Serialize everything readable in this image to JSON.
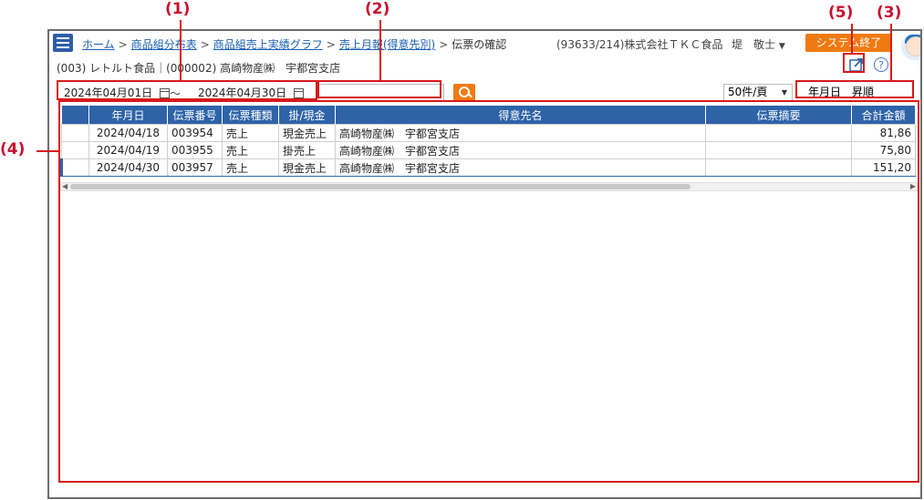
{
  "annotations": {
    "n1": "(1)",
    "n2": "(2)",
    "n3": "(3)",
    "n4": "(4)",
    "n5": "(5)"
  },
  "topbar": {
    "breadcrumbs": [
      "ホーム",
      "商品組分布表",
      "商品組売上実績グラフ",
      "売上月報(得意先別)"
    ],
    "current": "伝票の確認",
    "company": "(93633/214)株式会社ＴＫＣ食品",
    "user": "堤　敬士",
    "system_end": "システム終了"
  },
  "subline": "(003) レトルト食品｜(000002) 高崎物産㈱　宇都宮支店",
  "filter": {
    "date_from": "2024年04月01日",
    "tilde": "～",
    "date_to": "2024年04月30日",
    "search_placeholder": "",
    "per_page": "50件/頁",
    "sort": "年月日　昇順"
  },
  "table": {
    "headers": [
      "年月日",
      "伝票番号",
      "伝票種類",
      "掛/現金",
      "得意先名",
      "伝票摘要",
      "合計金額"
    ],
    "rows": [
      [
        "2024/04/18",
        "003954",
        "売上",
        "現金売上",
        "高崎物産㈱　宇都宮支店",
        "",
        "81,86"
      ],
      [
        "2024/04/19",
        "003955",
        "売上",
        "掛売上",
        "高崎物産㈱　宇都宮支店",
        "",
        "75,80"
      ],
      [
        "2024/04/30",
        "003957",
        "売上",
        "現金売上",
        "高崎物産㈱　宇都宮支店",
        "",
        "151,20"
      ]
    ]
  },
  "icons": {
    "menu": "hamburger-icon",
    "external": "external-link-icon",
    "help": "help-icon",
    "calendar": "calendar-icon",
    "search": "search-icon"
  },
  "colors": {
    "header": "#2e63a8",
    "accent": "#f07a12",
    "annotation": "#d7191c"
  }
}
